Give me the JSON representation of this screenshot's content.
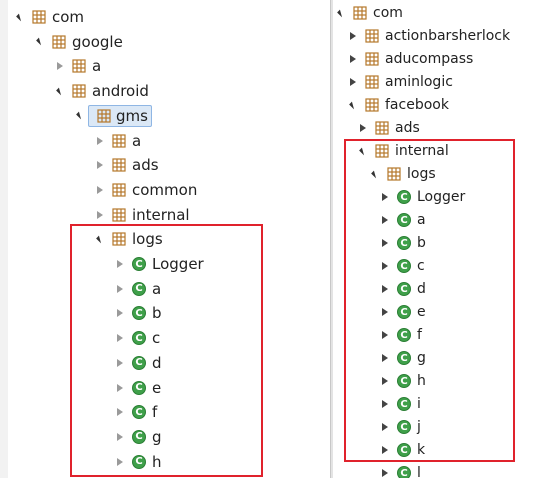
{
  "left_tree": {
    "com": "com",
    "google": "google",
    "a": "a",
    "android": "android",
    "gms": "gms",
    "gms_children": [
      "a",
      "ads",
      "common",
      "internal"
    ],
    "logs": "logs",
    "logs_children": [
      "Logger",
      "a",
      "b",
      "c",
      "d",
      "e",
      "f",
      "g",
      "h"
    ]
  },
  "right_tree": {
    "com": "com",
    "packages": [
      "actionbarsherlock",
      "aducompass",
      "aminlogic"
    ],
    "facebook": "facebook",
    "ads": "ads",
    "internal": "internal",
    "logs": "logs",
    "logs_children": [
      "Logger",
      "a",
      "b",
      "c",
      "d",
      "e",
      "f",
      "g",
      "h",
      "i",
      "j",
      "k",
      "l"
    ]
  },
  "colors": {
    "highlight": "#e0222c",
    "class_icon": "#3fa04a",
    "package_icon": "#b5772a",
    "selection": "#dbe8f6"
  },
  "icons": {
    "package": "package-icon",
    "class": "class-icon",
    "expanded": "expanded-triangle-icon",
    "collapsed": "collapsed-triangle-icon"
  }
}
